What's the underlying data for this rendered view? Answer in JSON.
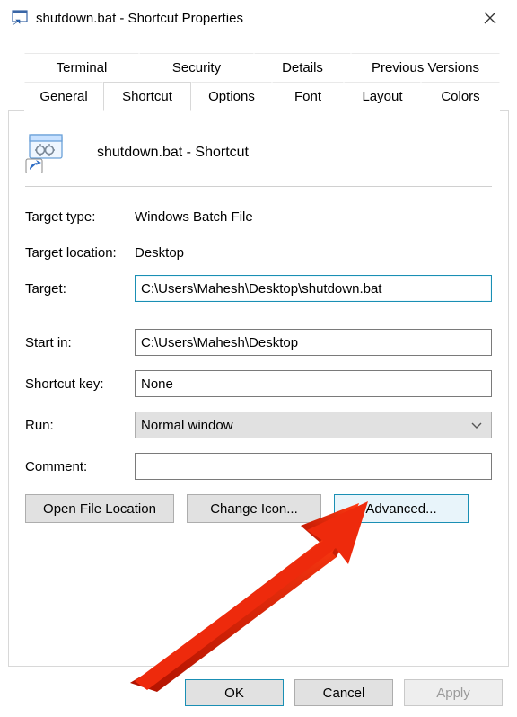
{
  "window": {
    "title": "shutdown.bat - Shortcut Properties"
  },
  "tabs": {
    "row1": {
      "terminal": "Terminal",
      "security": "Security",
      "details": "Details",
      "previous_versions": "Previous Versions"
    },
    "row2": {
      "general": "General",
      "shortcut": "Shortcut",
      "options": "Options",
      "font": "Font",
      "layout": "Layout",
      "colors": "Colors"
    },
    "active": "Shortcut"
  },
  "shortcut_panel": {
    "header_name": "shutdown.bat - Shortcut",
    "target_type_label": "Target type:",
    "target_type_value": "Windows Batch File",
    "target_location_label": "Target location:",
    "target_location_value": "Desktop",
    "target_label": "Target:",
    "target_value": "C:\\Users\\Mahesh\\Desktop\\shutdown.bat",
    "start_in_label": "Start in:",
    "start_in_value": "C:\\Users\\Mahesh\\Desktop",
    "shortcut_key_label": "Shortcut key:",
    "shortcut_key_value": "None",
    "run_label": "Run:",
    "run_value": "Normal window",
    "comment_label": "Comment:",
    "comment_value": "",
    "buttons": {
      "open_file_location": "Open File Location",
      "change_icon": "Change Icon...",
      "advanced": "Advanced..."
    }
  },
  "footer": {
    "ok": "OK",
    "cancel": "Cancel",
    "apply": "Apply"
  }
}
